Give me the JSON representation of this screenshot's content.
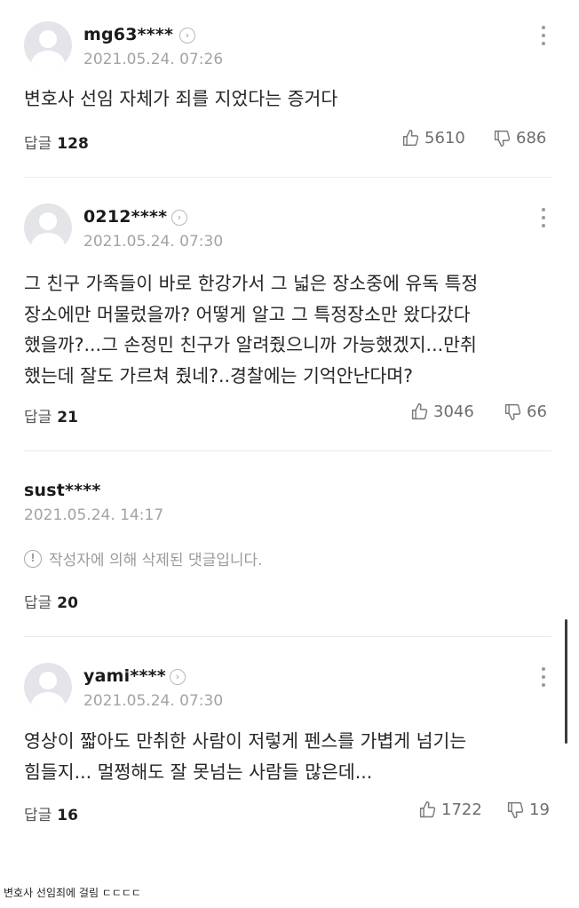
{
  "comments": [
    {
      "username": "mg63****",
      "date": "2021.05.24. 07:26",
      "lines": [
        "변호사 선임 자체가 죄를 지었다는 증거다"
      ],
      "reply_label": "답글",
      "reply_count": "128",
      "likes": "5610",
      "dislikes": "686"
    },
    {
      "username": "0212****",
      "date": "2021.05.24. 07:30",
      "lines": [
        "그 친구 가족들이 바로 한강가서 그 넓은 장소중에 유독 특정",
        "장소에만 머물렀을까? 어떻게 알고 그 특정장소만 왔다갔다",
        "했을까?...그 손정민 친구가 알려줬으니까 가능했겠지...만취",
        "했는데 잘도 가르쳐 줬네?..경찰에는 기억안난다며?"
      ],
      "reply_label": "답글",
      "reply_count": "21",
      "likes": "3046",
      "dislikes": "66"
    },
    {
      "username": "sust****",
      "date": "2021.05.24. 14:17",
      "deleted_notice": "작성자에 의해 삭제된 댓글입니다.",
      "reply_label": "답글",
      "reply_count": "20"
    },
    {
      "username": "yami****",
      "date": "2021.05.24. 07:30",
      "lines": [
        "영상이 짧아도 만취한 사람이 저렇게 펜스를 가볍게 넘기는",
        "힘들지... 멀쩡해도 잘 못넘는 사람들 많은데..."
      ],
      "reply_label": "답글",
      "reply_count": "16",
      "likes": "1722",
      "dislikes": "19"
    }
  ],
  "caption": "변호사 선임죄에 걸림 ㄷㄷㄷㄷ",
  "icons": {
    "profile": "default-avatar-icon",
    "chevron": "chevron-right-icon",
    "menu": "more-vertical-icon",
    "like": "thumbs-up-icon",
    "dislike": "thumbs-down-icon",
    "deleted": "exclamation-circle-icon"
  },
  "colors": {
    "text": "#262626",
    "meta": "#a3a3a3",
    "divider": "#ebebeb",
    "background": "#ffffff"
  }
}
